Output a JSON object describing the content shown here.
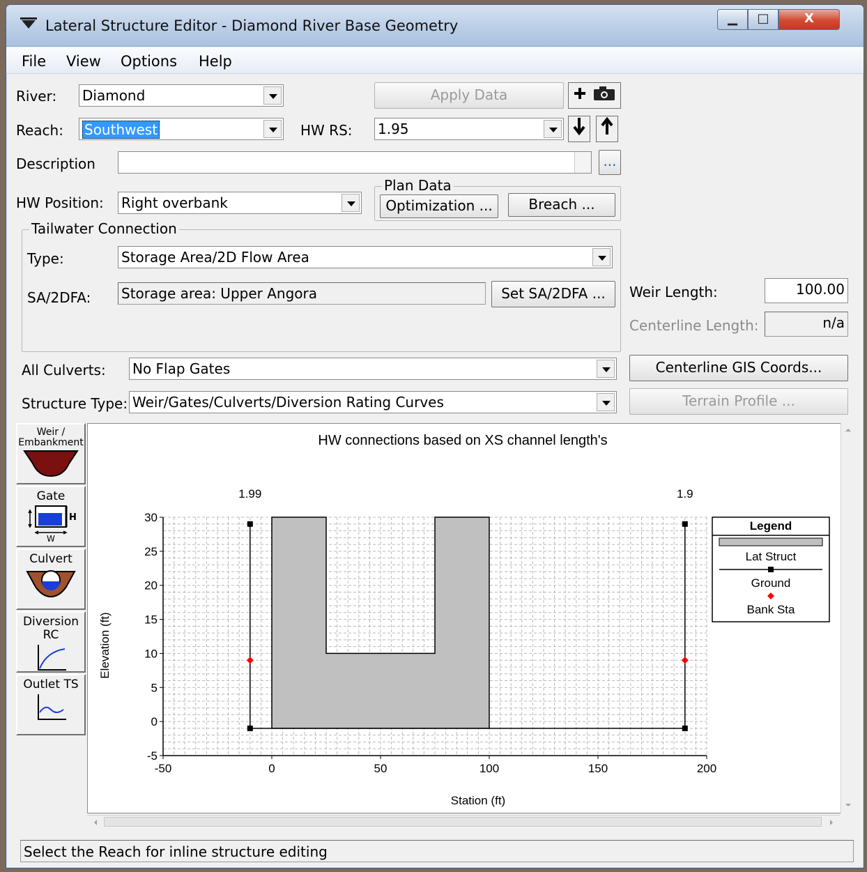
{
  "window": {
    "title": "Lateral Structure Editor - Diamond River Base Geometry",
    "min_glyph": "▁",
    "max_glyph": "□",
    "close_glyph": "X"
  },
  "menu": [
    "File",
    "View",
    "Options",
    "Help"
  ],
  "form": {
    "river_label": "River:",
    "river_value": "Diamond",
    "reach_label": "Reach:",
    "reach_value": "Southwest",
    "hwrs_label": "HW RS:",
    "hwrs_value": "1.95",
    "apply_label": "Apply Data",
    "description_label": "Description",
    "description_button": "...",
    "hw_position_label": "HW Position:",
    "hw_position_value": "Right overbank",
    "plan_data_label": "Plan Data",
    "optimization_label": "Optimization ...",
    "breach_label": "Breach ...",
    "tailwater_label": "Tailwater Connection",
    "type_label": "Type:",
    "type_value": "Storage Area/2D Flow Area",
    "sa_label": "SA/2DFA:",
    "sa_value": "Storage area: Upper Angora",
    "set_sa_label": "Set SA/2DFA ...",
    "weir_length_label": "Weir Length:",
    "weir_length_value": "100.00",
    "centerline_length_label": "Centerline Length:",
    "centerline_length_value": "n/a",
    "all_culverts_label": "All Culverts:",
    "all_culverts_value": "No Flap Gates",
    "centerline_gis_label": "Centerline GIS Coords...",
    "structure_type_label": "Structure Type:",
    "structure_type_value": "Weir/Gates/Culverts/Diversion Rating Curves",
    "terrain_profile_label": "Terrain Profile ..."
  },
  "tools": [
    {
      "label": "Weir / Embankment",
      "icon": "weir-icon"
    },
    {
      "label": "Gate",
      "icon": "gate-icon"
    },
    {
      "label": "Culvert",
      "icon": "culvert-icon"
    },
    {
      "label": "Diversion RC",
      "icon": "diversion-rc-icon"
    },
    {
      "label": "Outlet TS",
      "icon": "outlet-ts-icon"
    }
  ],
  "gate_icon_labels": {
    "h": "H",
    "w": "W"
  },
  "chart_data": {
    "type": "line",
    "title": "HW connections based on XS channel length's",
    "xlabel": "Station (ft)",
    "ylabel": "Elevation (ft)",
    "xlim": [
      -50,
      200
    ],
    "ylim": [
      -5,
      30
    ],
    "xticks": [
      -50,
      0,
      50,
      100,
      150,
      200
    ],
    "yticks": [
      -5,
      0,
      5,
      10,
      15,
      20,
      25,
      30
    ],
    "grid": true,
    "top_labels": [
      {
        "x": -10,
        "text": "1.99"
      },
      {
        "x": 190,
        "text": "1.9"
      }
    ],
    "series": [
      {
        "name": "Lat Struct",
        "kind": "polygon",
        "color": "#c0c0c0",
        "x": [
          0,
          0,
          25,
          25,
          75,
          75,
          100,
          100
        ],
        "y": [
          -1,
          30,
          30,
          10,
          10,
          30,
          30,
          -1
        ]
      },
      {
        "name": "Ground",
        "kind": "line",
        "color": "#000000",
        "x": [
          -10,
          -10,
          190,
          190
        ],
        "y": [
          29,
          -1,
          -1,
          29
        ]
      },
      {
        "name": "Bank Sta",
        "kind": "points",
        "color": "#ff0000",
        "x": [
          -10,
          190
        ],
        "y": [
          9,
          9
        ]
      }
    ],
    "legend": {
      "title": "Legend",
      "position": "right",
      "entries": [
        "Lat Struct",
        "Ground",
        "Bank Sta"
      ]
    }
  },
  "status": "Select the Reach for inline structure editing"
}
